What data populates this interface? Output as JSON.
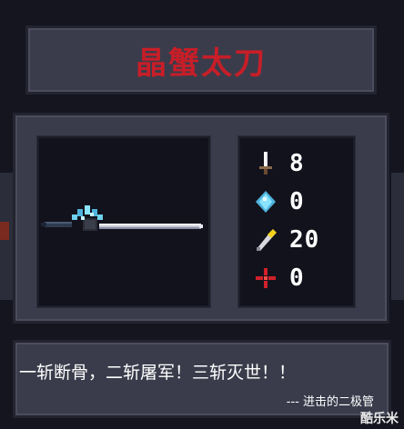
{
  "item": {
    "name": "晶蟹太刀"
  },
  "stats": [
    {
      "icon": "sword-damage-icon",
      "value": "8"
    },
    {
      "icon": "energy-crystal-icon",
      "value": "0"
    },
    {
      "icon": "critical-chance-icon",
      "value": "20"
    },
    {
      "icon": "accuracy-crosshair-icon",
      "value": "0"
    }
  ],
  "quote": {
    "text": "一斩断骨，二斩屠军！三斩灭世！！",
    "author": "--- 进击的二极管"
  },
  "watermark": "酷乐米",
  "colors": {
    "title": "#c81e28",
    "panel": "#3a3c4b",
    "inner": "#12121c",
    "background": "#14151f"
  }
}
